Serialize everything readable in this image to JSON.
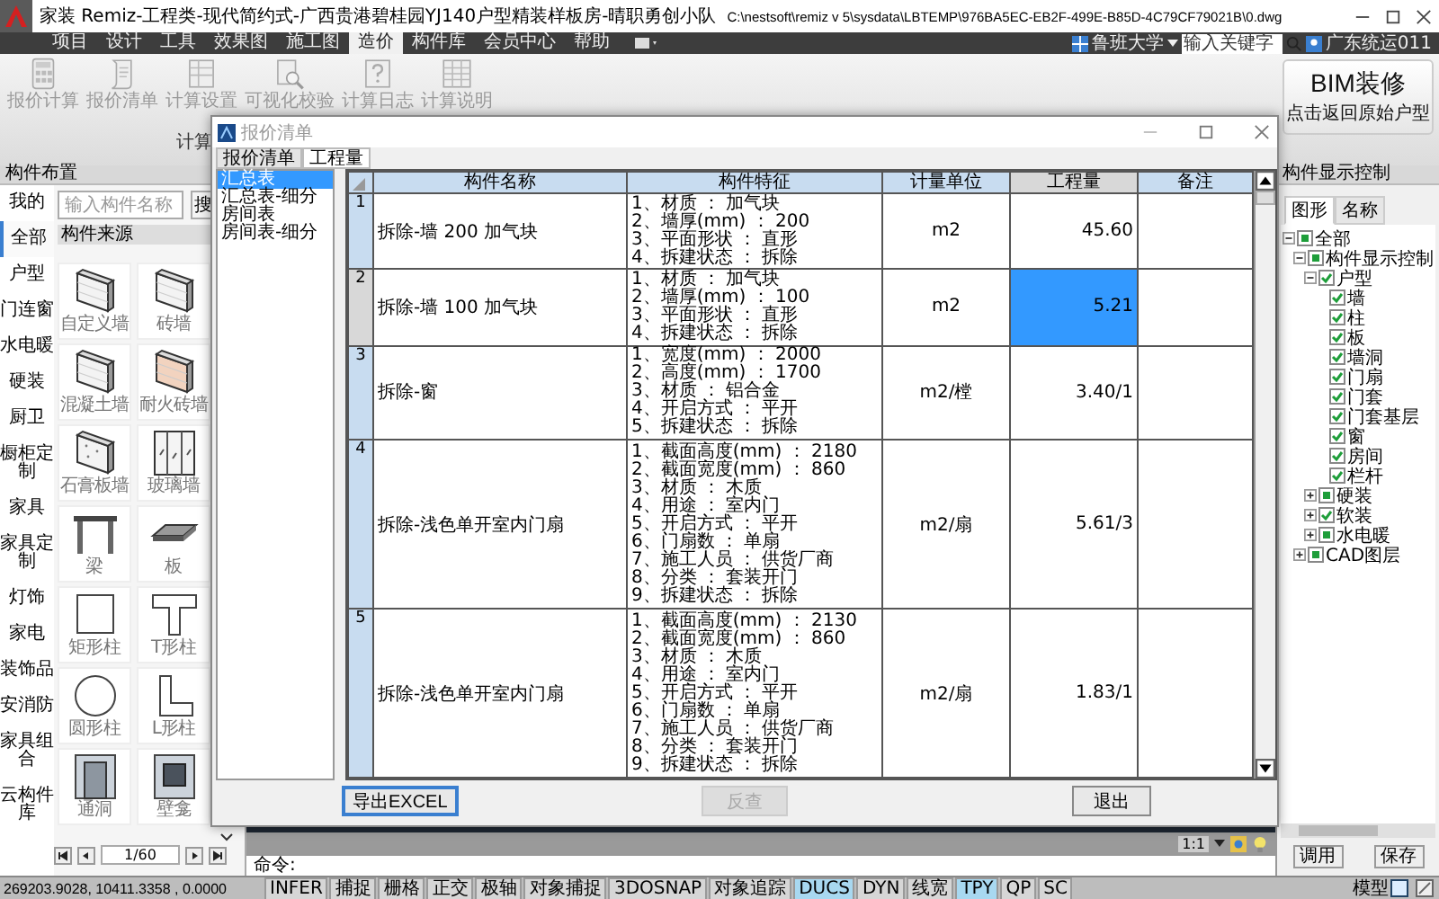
{
  "window": {
    "title": "家装 Remiz-工程类-现代简约式-广西贵港碧桂园YJ140户型精装样板房-晴职勇创小队",
    "path": "C:\\nestsoft\\remiz v 5\\sysdata\\LBTEMP\\976BA5EC-EB2F-499E-B85D-4C79CF79021B\\0.dwg"
  },
  "menu": [
    {
      "label": "项目",
      "selected": false
    },
    {
      "label": "设计",
      "selected": false
    },
    {
      "label": "工具",
      "selected": false
    },
    {
      "label": "效果图",
      "selected": false
    },
    {
      "label": "施工图",
      "selected": false
    },
    {
      "label": "造价",
      "selected": true
    },
    {
      "label": "构件库",
      "selected": false
    },
    {
      "label": "会员中心",
      "selected": false
    },
    {
      "label": "帮助",
      "selected": false
    }
  ],
  "menu_right": {
    "school": "鲁班大学",
    "search_placeholder": "输入关键字",
    "user": "广东统运011"
  },
  "ribbon": {
    "items": [
      {
        "label": "报价计算",
        "kind": "calc"
      },
      {
        "label": "报价清单",
        "kind": "scroll"
      },
      {
        "label": "计算设置",
        "kind": "table"
      },
      {
        "label": "可视化校验",
        "kind": "magnifier"
      },
      {
        "label": "计算日志",
        "kind": "help"
      },
      {
        "label": "计算说明",
        "kind": "grid"
      }
    ],
    "group": "计算",
    "bim_title": "BIM装修",
    "bim_subtitle": "点击返回原始户型"
  },
  "left_panel": {
    "title": "构件布置",
    "categories": [
      {
        "label": "我的",
        "selected": false
      },
      {
        "label": "全部",
        "selected": true
      },
      {
        "label": "户型",
        "selected": false
      },
      {
        "label": "门连窗",
        "selected": false
      },
      {
        "label": "水电暖",
        "selected": false
      },
      {
        "label": "硬装",
        "selected": false
      },
      {
        "label": "厨卫",
        "selected": false
      },
      {
        "label": "橱柜定制",
        "selected": false
      },
      {
        "label": "家具",
        "selected": false
      },
      {
        "label": "家具定制",
        "selected": false
      },
      {
        "label": "灯饰",
        "selected": false
      },
      {
        "label": "家电",
        "selected": false
      },
      {
        "label": "装饰品",
        "selected": false
      },
      {
        "label": "安消防",
        "selected": false
      },
      {
        "label": "家具组合",
        "selected": false
      },
      {
        "label": "云构件库",
        "selected": false
      }
    ],
    "search_placeholder": "输入构件名称",
    "search_button": "搜",
    "source_tag": "构件来源",
    "items": [
      {
        "label": "自定义墙",
        "kind": "wall"
      },
      {
        "label": "砖墙",
        "kind": "wall"
      },
      {
        "label": "混凝土墙",
        "kind": "wall"
      },
      {
        "label": "耐火砖墙",
        "kind": "brick"
      },
      {
        "label": "石膏板墙",
        "kind": "plaster"
      },
      {
        "label": "玻璃墙",
        "kind": "glass"
      },
      {
        "label": "梁",
        "kind": "beam"
      },
      {
        "label": "板",
        "kind": "slab"
      },
      {
        "label": "矩形柱",
        "kind": "rect"
      },
      {
        "label": "T形柱",
        "kind": "tee"
      },
      {
        "label": "圆形柱",
        "kind": "circle"
      },
      {
        "label": "L形柱",
        "kind": "ell"
      },
      {
        "label": "通洞",
        "kind": "opening"
      },
      {
        "label": "壁龛",
        "kind": "niche"
      }
    ],
    "page": "1/60"
  },
  "dialog": {
    "title": "报价清单",
    "tabs": [
      {
        "label": "报价清单",
        "selected": false
      },
      {
        "label": "工程量",
        "selected": true
      }
    ],
    "lists": [
      {
        "label": "汇总表",
        "selected": true
      },
      {
        "label": "汇总表-细分",
        "selected": false
      },
      {
        "label": "房间表",
        "selected": false
      },
      {
        "label": "房间表-细分",
        "selected": false
      }
    ],
    "table": {
      "columns": [
        {
          "label": "构件名称",
          "selected": false
        },
        {
          "label": "构件特征",
          "selected": false
        },
        {
          "label": "计量单位",
          "selected": false
        },
        {
          "label": "工程量",
          "selected": true
        },
        {
          "label": "备注",
          "selected": false
        }
      ],
      "rows": [
        {
          "index": "1",
          "name": "拆除-墙 200 加气块",
          "features": [
            "1、材质 ： 加气块",
            "2、墙厚(mm) ： 200",
            "3、平面形状 ： 直形",
            "4、拆建状态 ： 拆除"
          ],
          "unit": "m2",
          "quantity": "45.60",
          "selected": false
        },
        {
          "index": "2",
          "name": "拆除-墙 100 加气块",
          "features": [
            "1、材质 ： 加气块",
            "2、墙厚(mm) ： 100",
            "3、平面形状 ： 直形",
            "4、拆建状态 ： 拆除"
          ],
          "unit": "m2",
          "quantity": "5.21",
          "selected": true
        },
        {
          "index": "3",
          "name": "拆除-窗",
          "features": [
            "1、宽度(mm) ： 2000",
            "2、高度(mm) ： 1700",
            "3、材质 ： 铝合金",
            "4、开启方式 ： 平开",
            "5、拆建状态 ： 拆除"
          ],
          "unit": "m2/樘",
          "quantity": "3.40/1",
          "selected": false
        },
        {
          "index": "4",
          "name": "拆除-浅色单开室内门扇",
          "features": [
            "1、截面高度(mm) ： 2180",
            "2、截面宽度(mm) ： 860",
            "3、材质 ： 木质",
            "4、用途 ： 室内门",
            "5、开启方式 ： 平开",
            "6、门扇数 ： 单扇",
            "7、施工人员 ： 供货厂商",
            "8、分类 ： 套装开门",
            "9、拆建状态 ： 拆除"
          ],
          "unit": "m2/扇",
          "quantity": "5.61/3",
          "selected": false
        },
        {
          "index": "5",
          "name": "拆除-浅色单开室内门扇",
          "features": [
            "1、截面高度(mm) ： 2130",
            "2、截面宽度(mm) ： 860",
            "3、材质 ： 木质",
            "4、用途 ： 室内门",
            "5、开启方式 ： 平开",
            "6、门扇数 ： 单扇",
            "7、施工人员 ： 供货厂商",
            "8、分类 ： 套装开门",
            "9、拆建状态 ： 拆除"
          ],
          "unit": "m2/扇",
          "quantity": "1.83/1",
          "selected": false
        }
      ]
    },
    "buttons": [
      {
        "label": "导出EXCEL",
        "disabled": false
      },
      {
        "label": "反查",
        "disabled": true
      },
      {
        "label": "退出",
        "disabled": false
      }
    ]
  },
  "right_panel": {
    "title": "构件显示控制",
    "tabs": [
      {
        "label": "图形",
        "selected": true
      },
      {
        "label": "名称",
        "selected": false
      }
    ],
    "tree": [
      {
        "label": "全部",
        "partial": true,
        "expanded": true,
        "children": [
          {
            "label": "构件显示控制",
            "partial": true,
            "expanded": true,
            "children": [
              {
                "label": "户型",
                "partial": false,
                "expanded": true,
                "children": [
                  {
                    "label": "墙",
                    "partial": false
                  },
                  {
                    "label": "柱",
                    "partial": false
                  },
                  {
                    "label": "板",
                    "partial": false
                  },
                  {
                    "label": "墙洞",
                    "partial": false
                  },
                  {
                    "label": "门扇",
                    "partial": false
                  },
                  {
                    "label": "门套",
                    "partial": false
                  },
                  {
                    "label": "门套基层",
                    "partial": false
                  },
                  {
                    "label": "窗",
                    "partial": false
                  },
                  {
                    "label": "房间",
                    "partial": false
                  },
                  {
                    "label": "栏杆",
                    "partial": false
                  }
                ]
              },
              {
                "label": "硬装",
                "partial": true,
                "expanded": false
              },
              {
                "label": "软装",
                "partial": false,
                "expanded": false
              },
              {
                "label": "水电暖",
                "partial": true,
                "expanded": false
              }
            ]
          },
          {
            "label": "CAD图层",
            "partial": true,
            "expanded": false
          }
        ]
      }
    ],
    "buttons": [
      "调用",
      "保存"
    ]
  },
  "command": {
    "prompt": "命令:"
  },
  "status_bar": {
    "coordinates": "269203.9028, 10411.3358 , 0.0000",
    "toggles": [
      {
        "label": "INFER",
        "on": false
      },
      {
        "label": "捕捉",
        "on": false
      },
      {
        "label": "栅格",
        "on": false
      },
      {
        "label": "正交",
        "on": false
      },
      {
        "label": "极轴",
        "on": false
      },
      {
        "label": "对象捕捉",
        "on": false
      },
      {
        "label": "3DOSNAP",
        "on": false
      },
      {
        "label": "对象追踪",
        "on": false
      },
      {
        "label": "DUCS",
        "on": true
      },
      {
        "label": "DYN",
        "on": false
      },
      {
        "label": "线宽",
        "on": false
      },
      {
        "label": "TPY",
        "on": true
      },
      {
        "label": "QP",
        "on": false
      },
      {
        "label": "SC",
        "on": false
      }
    ],
    "model": "模型",
    "scale": "1:1"
  }
}
